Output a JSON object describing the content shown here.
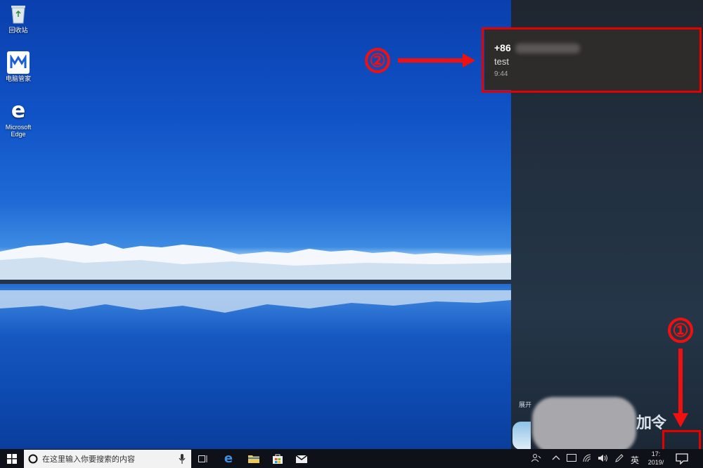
{
  "desktop": {
    "icons": [
      {
        "label": "回收站",
        "icon": "recycle-bin-icon"
      },
      {
        "label": "电脑管家",
        "icon": "pc-manager-icon"
      },
      {
        "label": "Microsoft Edge",
        "icon": "edge-icon"
      }
    ]
  },
  "notification": {
    "sender_prefix": "+86",
    "message": "test",
    "time": "9:44"
  },
  "action_center": {
    "expand_label": "展开",
    "tile_text": "加令"
  },
  "annotations": {
    "step1": "①",
    "step2": "②",
    "color": "#e60000"
  },
  "taskbar": {
    "search_placeholder": "在这里输入你要搜索的内容",
    "input_language": "英",
    "clock_time": "17:",
    "clock_date": "2019/"
  }
}
